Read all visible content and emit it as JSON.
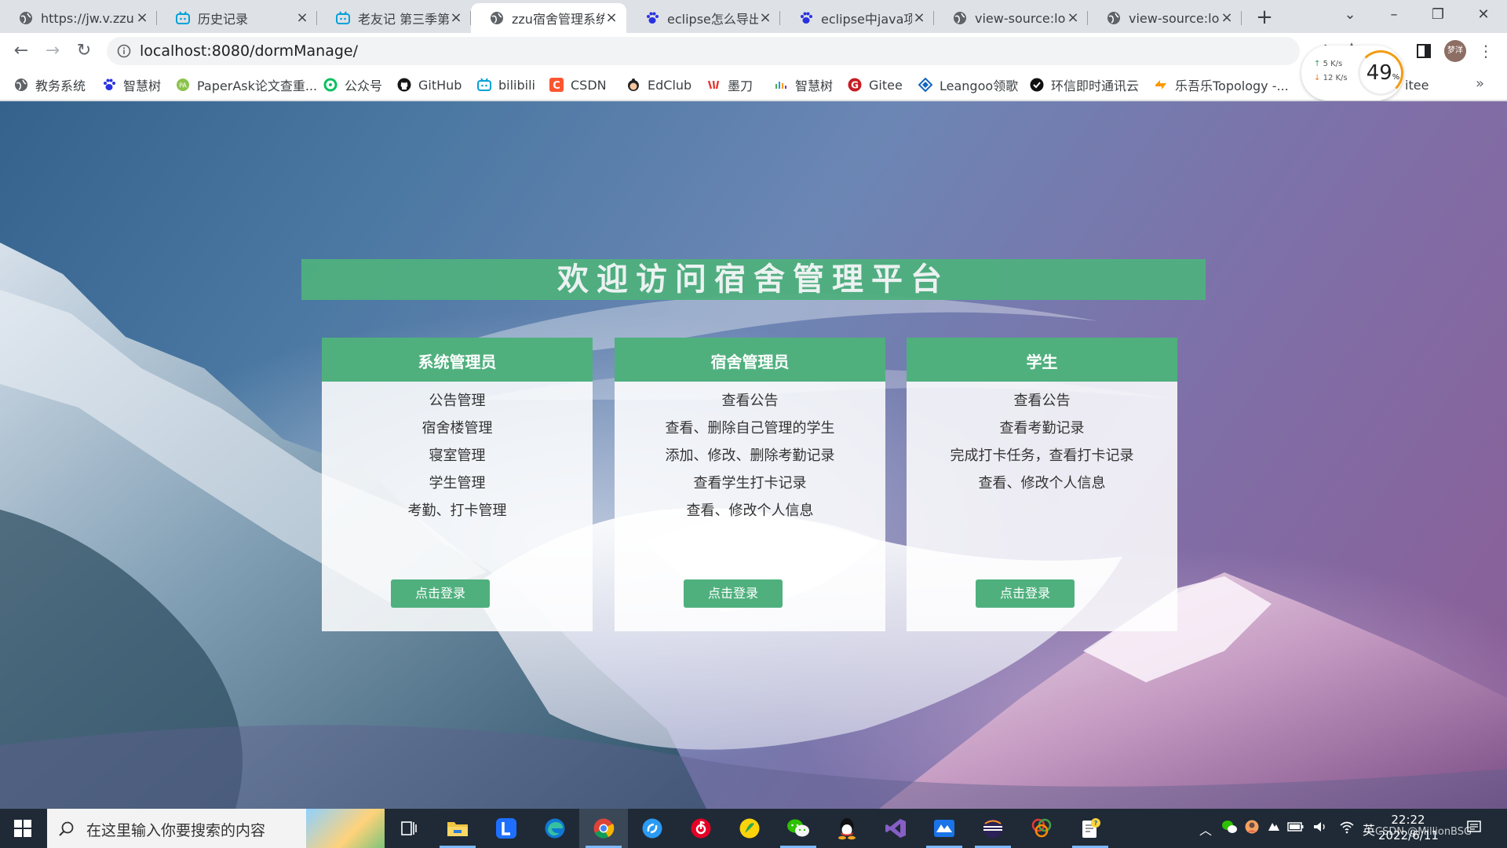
{
  "browser": {
    "tabs": [
      {
        "label": "https://jw.v.zzu.e",
        "icon": "globe-icon"
      },
      {
        "label": "历史记录",
        "icon": "bilibili-icon"
      },
      {
        "label": "老友记 第三季第",
        "icon": "bilibili-icon"
      },
      {
        "label": "zzu宿舍管理系统",
        "icon": "globe-icon",
        "active": true
      },
      {
        "label": "eclipse怎么导出",
        "icon": "baidu-paw-icon"
      },
      {
        "label": "eclipse中java项目",
        "icon": "baidu-paw-icon"
      },
      {
        "label": "view-source:loca",
        "icon": "globe-icon"
      },
      {
        "label": "view-source:loca",
        "icon": "globe-icon"
      }
    ],
    "url": "localhost:8080/dormManage/",
    "profile_name": "梦洋",
    "bookmarks": [
      {
        "label": "教务系统",
        "icon": "globe-icon"
      },
      {
        "label": "智慧树",
        "icon": "baidu-paw-icon"
      },
      {
        "label": "PaperAsk论文查重...",
        "icon": "paperask-icon"
      },
      {
        "label": "公众号",
        "icon": "wechat-mp-icon"
      },
      {
        "label": "GitHub",
        "icon": "github-icon"
      },
      {
        "label": "bilibili",
        "icon": "bilibili-icon"
      },
      {
        "label": "CSDN",
        "icon": "csdn-icon"
      },
      {
        "label": "EdClub",
        "icon": "edclub-icon"
      },
      {
        "label": "墨刀",
        "icon": "modao-icon"
      },
      {
        "label": "智慧树",
        "icon": "zhihuishu-icon"
      },
      {
        "label": "Gitee",
        "icon": "gitee-icon"
      },
      {
        "label": "Leangoo领歌",
        "icon": "leangoo-icon"
      },
      {
        "label": "环信即时通讯云",
        "icon": "easemob-icon"
      },
      {
        "label": "乐吾乐Topology -...",
        "icon": "topology-icon"
      },
      {
        "label": "itee",
        "icon": ""
      }
    ]
  },
  "net_monitor": {
    "up": "5 K/s",
    "down": "12 K/s",
    "percent": "49",
    "percent_unit": "%"
  },
  "page": {
    "title": "欢迎访问宿舍管理平台",
    "cards": [
      {
        "header": "系统管理员",
        "items": [
          "公告管理",
          "宿舍楼管理",
          "寝室管理",
          "学生管理",
          "考勤、打卡管理"
        ],
        "button": "点击登录"
      },
      {
        "header": "宿舍管理员",
        "items": [
          "查看公告",
          "查看、删除自己管理的学生",
          "添加、修改、删除考勤记录",
          "查看学生打卡记录",
          "查看、修改个人信息"
        ],
        "button": "点击登录"
      },
      {
        "header": "学生",
        "items": [
          "查看公告",
          "查看考勤记录",
          "完成打卡任务，查看打卡记录",
          "查看、修改个人信息"
        ],
        "button": "点击登录"
      }
    ],
    "watermark": "CSDN @MillionBSG"
  },
  "taskbar": {
    "search_placeholder": "在这里输入你要搜索的内容",
    "ime": "英",
    "time": "22:22",
    "date": "2022/6/11"
  },
  "colors": {
    "accent_green": "#4fb07e",
    "taskbar": "#1f2a36"
  }
}
